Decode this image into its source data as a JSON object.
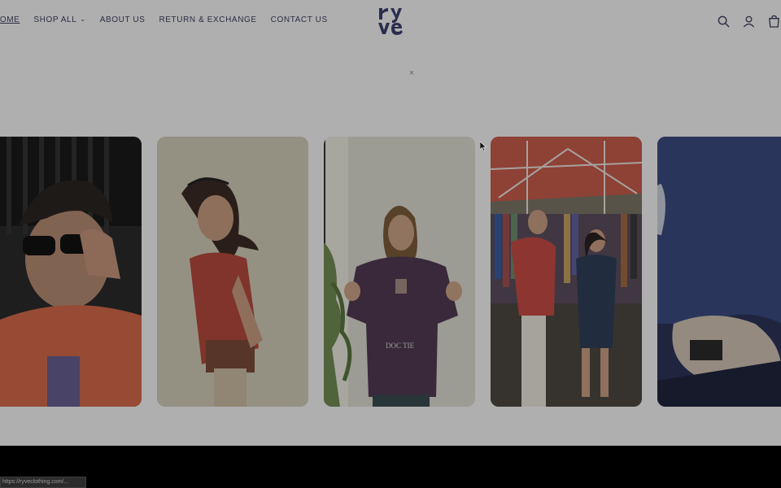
{
  "nav": {
    "items": [
      {
        "label": "HOME",
        "active": true
      },
      {
        "label": "SHOP ALL",
        "dropdown": true
      },
      {
        "label": "ABOUT US"
      },
      {
        "label": "RETURN & EXCHANGE"
      },
      {
        "label": "CONTACT US"
      }
    ]
  },
  "brand": {
    "logo_text": "ryve",
    "accent": "#3c3f6e"
  },
  "header_icons": [
    "search-icon",
    "account-icon",
    "cart-icon"
  ],
  "close_symbol": "×",
  "gallery": {
    "cards": [
      {
        "name": "video-card-1"
      },
      {
        "name": "video-card-2"
      },
      {
        "name": "video-card-3",
        "caption": "DOC TIE"
      },
      {
        "name": "video-card-4"
      },
      {
        "name": "video-card-5"
      }
    ]
  },
  "status_bar": {
    "text": "https://ryveclothing.com/..."
  }
}
